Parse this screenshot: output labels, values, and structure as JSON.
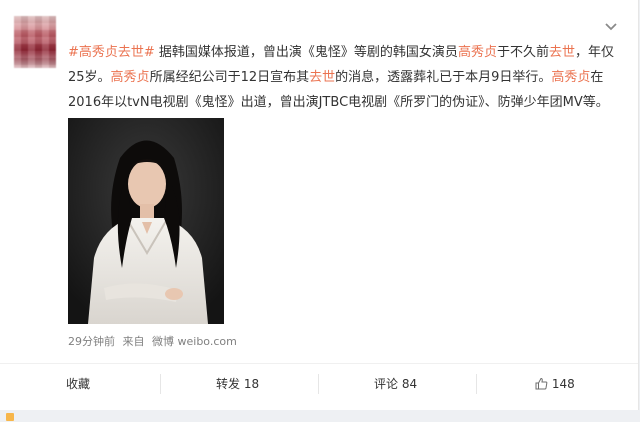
{
  "post": {
    "segments": [
      {
        "text": "#高秀贞去世#",
        "style": "tag"
      },
      {
        "text": " 据韩国媒体报道，曾出演《鬼怪》等剧的韩国女演员",
        "style": "plain"
      },
      {
        "text": "高秀贞",
        "style": "hl"
      },
      {
        "text": "于不久前",
        "style": "plain"
      },
      {
        "text": "去世",
        "style": "hl"
      },
      {
        "text": "，年仅25岁。",
        "style": "plain"
      },
      {
        "text": "高秀贞",
        "style": "hl"
      },
      {
        "text": "所属经纪公司于12日宣布其",
        "style": "plain"
      },
      {
        "text": "去世",
        "style": "hl"
      },
      {
        "text": "的消息，透露葬礼已于本月9日举行。",
        "style": "plain"
      },
      {
        "text": "高秀贞",
        "style": "hl"
      },
      {
        "text": "在2016年以tvN电视剧《鬼怪》出道，曾出演JTBC电视剧《所罗门的伪证》、防弹少年团MV等。",
        "style": "plain"
      }
    ],
    "meta": {
      "time": "29分钟前",
      "from_label": "来自",
      "source": "微博 weibo.com"
    },
    "colors": {
      "accent": "#eb7350",
      "text": "#333333",
      "meta": "#808080"
    }
  },
  "actions": {
    "favorite": {
      "label": "收藏"
    },
    "repost": {
      "label": "转发",
      "count": "18"
    },
    "comment": {
      "label": "评论",
      "count": "84"
    },
    "like": {
      "count": "148",
      "icon": "thumbs-up-icon"
    }
  }
}
